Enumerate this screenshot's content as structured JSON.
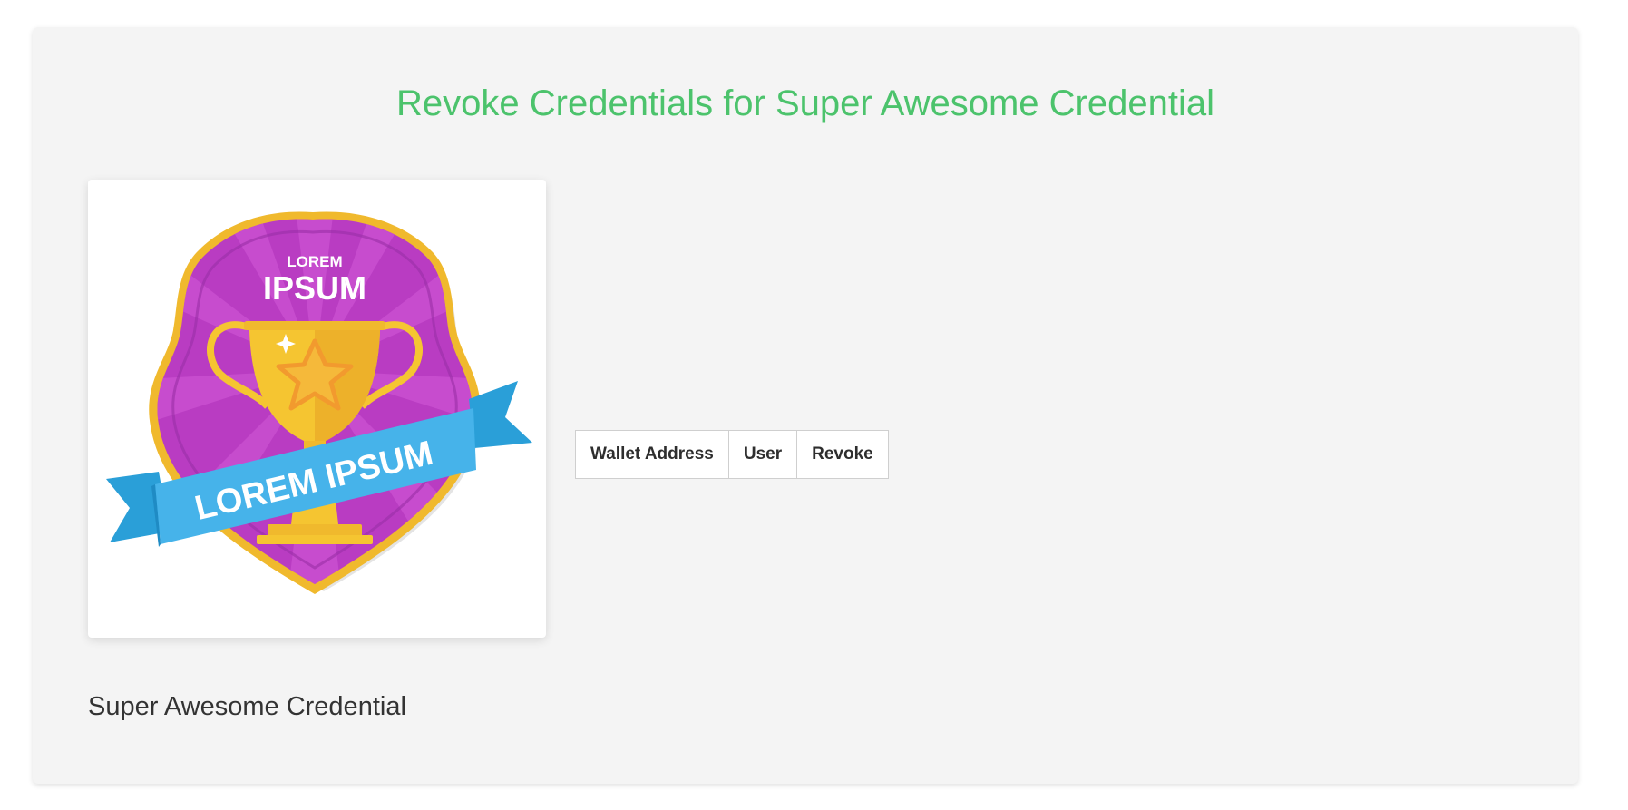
{
  "page": {
    "title": "Revoke Credentials for Super Awesome Credential",
    "accent_color": "#4cc36c"
  },
  "credential": {
    "name": "Super Awesome Credential",
    "badge": {
      "top_text": "LOREM",
      "main_text": "IPSUM",
      "ribbon_text": "LOREM IPSUM",
      "icon": "trophy-star-badge"
    }
  },
  "table": {
    "columns": [
      "Wallet Address",
      "User",
      "Revoke"
    ],
    "rows": []
  }
}
